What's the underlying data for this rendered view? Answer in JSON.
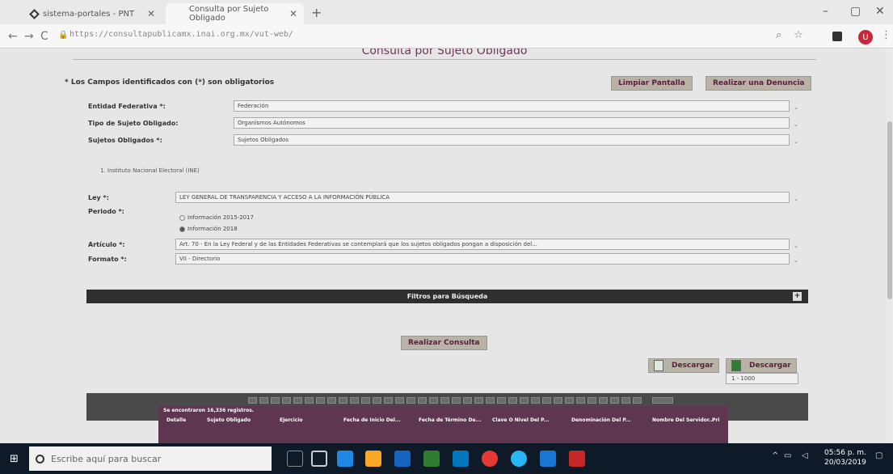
{
  "browser": {
    "tabs": [
      {
        "label": "sistema-portales - PNT"
      },
      {
        "label": "Consulta por Sujeto Obligado"
      }
    ],
    "new_tab": "+",
    "url": "https://consultapublicamx.inai.org.mx/vut-web/",
    "nav": {
      "back": "←",
      "forward": "→",
      "reload": "C"
    },
    "window": {
      "minimize": "–",
      "maximize": "▢",
      "close": "✕"
    },
    "avatar_initial": "U",
    "tab_close": "✕"
  },
  "page": {
    "title": "Consulta por Sujeto Obligado",
    "required_note": "* Los Campos identificados con (*) son obligatorios",
    "buttons": {
      "clear": "Limpiar Pantalla",
      "complaint": "Realizar una Denuncia",
      "search": "Realizar Consulta",
      "download1": "Descargar",
      "download2": "Descargar"
    },
    "form": {
      "entidad_label": "Entidad Federativa *:",
      "entidad_value": "Federación",
      "tipo_label": "Tipo de Sujeto Obligado:",
      "tipo_value": "Organismos Autónomos",
      "sujetos_label": "Sujetos Obligados *:",
      "sujetos_value": "Sujetos Obligados",
      "selected_subject": "1. Instituto Nacional Electoral (INE)",
      "ley_label": "Ley *:",
      "ley_value": "LEY GENERAL DE TRANSPARENCIA Y ACCESO A LA INFORMACIÓN PÚBLICA",
      "periodo_label": "Periodo *:",
      "periodo_opt1": "Información 2015-2017",
      "periodo_opt2": "Información 2018",
      "articulo_label": "Artículo *:",
      "articulo_value": "Art. 70 - En la Ley Federal y de las Entidades Federativas se contemplará que los sujetos obligados pongan a disposición del...",
      "formato_label": "Formato *:",
      "formato_value": "VII - Directorio",
      "dropdown_glyph": "⌄"
    },
    "filters_label": "Filtros para Búsqueda",
    "filters_plus": "+",
    "rows_per_page": "1 - 1000",
    "results": {
      "found": "Se encontraron 16,336 registros.",
      "headers": [
        "Detalle",
        "Sujeto Obligado",
        "Ejercicio",
        "Fecha de Inicio Del...",
        "Fecha de Término De...",
        "Clave O Nivel Del P...",
        "Denominación Del P...",
        "Nombre Del Servidor...",
        "Pri"
      ]
    }
  },
  "taskbar": {
    "search_placeholder": "Escribe aquí para buscar",
    "time": "05:56 p. m.",
    "date": "20/03/2019"
  },
  "colors": {
    "accent": "#5a1f3e",
    "button_bg": "#b9b3a6",
    "filters_bar": "#2f2f2f",
    "results_header": "#5f3650",
    "taskbar": "#0f1a29"
  }
}
